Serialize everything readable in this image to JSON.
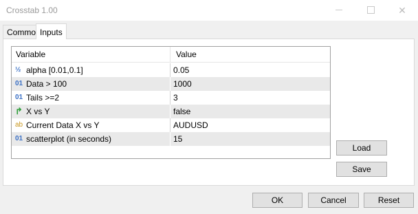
{
  "window": {
    "title": "Crosstab 1.00"
  },
  "tabs": [
    {
      "label": "Common"
    },
    {
      "label": "Inputs"
    }
  ],
  "grid": {
    "headers": {
      "variable": "Variable",
      "value": "Value"
    },
    "rows": [
      {
        "icon": "½",
        "variable": "alpha [0.01,0.1]",
        "value": "0.05"
      },
      {
        "icon": "01",
        "variable": "Data > 100",
        "value": "1000"
      },
      {
        "icon": "01",
        "variable": "Tails >=2",
        "value": "3"
      },
      {
        "icon": "↱",
        "variable": "X vs Y",
        "value": "false"
      },
      {
        "icon": "ab",
        "variable": "Current Data X vs Y",
        "value": "AUDUSD"
      },
      {
        "icon": "01",
        "variable": "scatterplot (in seconds)",
        "value": "15"
      }
    ]
  },
  "side_buttons": {
    "load": "Load",
    "save": "Save"
  },
  "footer": {
    "ok": "OK",
    "cancel": "Cancel",
    "reset": "Reset"
  },
  "window_controls": {
    "close_glyph": "✕"
  }
}
